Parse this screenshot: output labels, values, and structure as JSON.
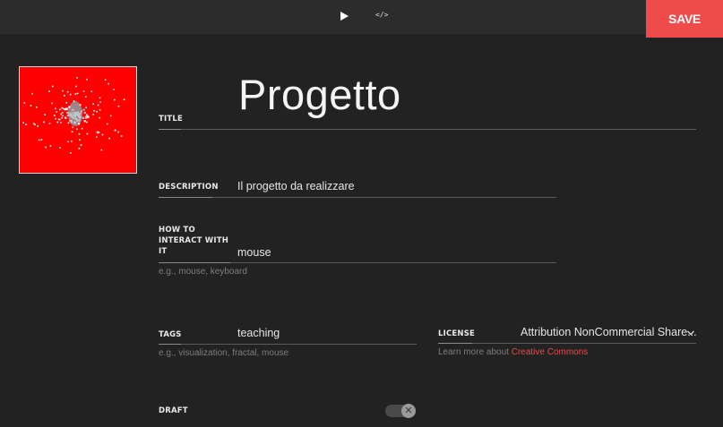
{
  "topbar": {
    "code_label": "</>",
    "save_label": "SAVE",
    "accent_color": "#ef4b4b"
  },
  "form": {
    "title": {
      "label": "TITLE",
      "value": "Progetto"
    },
    "description": {
      "label": "DESCRIPTION",
      "value": "Il progetto da realizzare"
    },
    "interact": {
      "label_lines": [
        "HOW TO",
        "INTERACT WITH",
        "IT"
      ],
      "value": "mouse",
      "hint": "e.g., mouse, keyboard"
    },
    "tags": {
      "label": "TAGS",
      "value": "teaching",
      "hint": "e.g., visualization, fractal, mouse"
    },
    "license": {
      "label": "LICENSE",
      "value": "Attribution NonCommercial Share...",
      "hint_prefix": "Learn more about ",
      "hint_link": "Creative Commons"
    },
    "draft": {
      "label": "DRAFT",
      "toggle_symbol": "✕",
      "enabled": false
    }
  },
  "icons": {
    "play": "play-icon",
    "code": "code-icon",
    "chevron": "chevron-down-icon",
    "close": "close-icon"
  }
}
